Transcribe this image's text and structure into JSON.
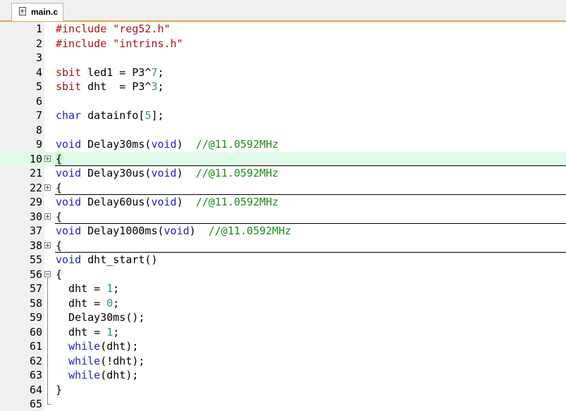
{
  "tab": {
    "label": "main.c",
    "icon": "c-file-icon"
  },
  "colors": {
    "tab_accent": "#d9a844",
    "current_line": "#e0fbe8",
    "keyword": "#1f1fc8",
    "string": "#a31515",
    "number": "#3a8a8a",
    "comment": "#1f8a1f"
  },
  "lines": [
    {
      "n": "1",
      "tokens": [
        [
          "pre",
          "#include"
        ],
        [
          "",
          " "
        ],
        [
          "str",
          "\"reg52.h\""
        ]
      ]
    },
    {
      "n": "2",
      "tokens": [
        [
          "pre",
          "#include"
        ],
        [
          "",
          " "
        ],
        [
          "str",
          "\"intrins.h\""
        ]
      ]
    },
    {
      "n": "3",
      "tokens": []
    },
    {
      "n": "4",
      "tokens": [
        [
          "pre",
          "sbit"
        ],
        [
          "",
          " led1 = P3^"
        ],
        [
          "num",
          "7"
        ],
        [
          "",
          ";"
        ]
      ]
    },
    {
      "n": "5",
      "tokens": [
        [
          "pre",
          "sbit"
        ],
        [
          "",
          " dht  = P3^"
        ],
        [
          "num",
          "3"
        ],
        [
          "",
          ";"
        ]
      ]
    },
    {
      "n": "6",
      "tokens": []
    },
    {
      "n": "7",
      "tokens": [
        [
          "kw",
          "char"
        ],
        [
          "",
          " datainfo["
        ],
        [
          "num",
          "5"
        ],
        [
          "",
          "];"
        ]
      ]
    },
    {
      "n": "8",
      "tokens": []
    },
    {
      "n": "9",
      "tokens": [
        [
          "kw",
          "void"
        ],
        [
          "",
          " Delay30ms("
        ],
        [
          "kw",
          "void"
        ],
        [
          "",
          ")  "
        ],
        [
          "cmt",
          "//@11.0592MHz"
        ]
      ]
    },
    {
      "n": "10",
      "tokens": [
        [
          "brace-hl",
          "{"
        ]
      ],
      "fold": "plus",
      "current": true,
      "sep": true
    },
    {
      "n": "21",
      "tokens": [
        [
          "kw",
          "void"
        ],
        [
          "",
          " Delay30us("
        ],
        [
          "kw",
          "void"
        ],
        [
          "",
          ")  "
        ],
        [
          "cmt",
          "//@11.0592MHz"
        ]
      ]
    },
    {
      "n": "22",
      "tokens": [
        [
          "",
          "{"
        ]
      ],
      "fold": "plus",
      "sep": true
    },
    {
      "n": "29",
      "tokens": [
        [
          "kw",
          "void"
        ],
        [
          "",
          " Delay60us("
        ],
        [
          "kw",
          "void"
        ],
        [
          "",
          ")  "
        ],
        [
          "cmt",
          "//@11.0592MHz"
        ]
      ]
    },
    {
      "n": "30",
      "tokens": [
        [
          "",
          "{"
        ]
      ],
      "fold": "plus",
      "sep": true
    },
    {
      "n": "37",
      "tokens": [
        [
          "kw",
          "void"
        ],
        [
          "",
          " Delay1000ms("
        ],
        [
          "kw",
          "void"
        ],
        [
          "",
          ")  "
        ],
        [
          "cmt",
          "//@11.0592MHz"
        ]
      ]
    },
    {
      "n": "38",
      "tokens": [
        [
          "",
          "{"
        ]
      ],
      "fold": "plus",
      "sep": true
    },
    {
      "n": "55",
      "tokens": [
        [
          "kw",
          "void"
        ],
        [
          "",
          " dht_start()"
        ]
      ]
    },
    {
      "n": "56",
      "tokens": [
        [
          "",
          "{"
        ]
      ],
      "fold": "minus"
    },
    {
      "n": "57",
      "tokens": [
        [
          "",
          "  dht = "
        ],
        [
          "num",
          "1"
        ],
        [
          "",
          ";"
        ]
      ]
    },
    {
      "n": "58",
      "tokens": [
        [
          "",
          "  dht = "
        ],
        [
          "num",
          "0"
        ],
        [
          "",
          ";"
        ]
      ]
    },
    {
      "n": "59",
      "tokens": [
        [
          "",
          "  Delay30ms();"
        ]
      ]
    },
    {
      "n": "60",
      "tokens": [
        [
          "",
          "  dht = "
        ],
        [
          "num",
          "1"
        ],
        [
          "",
          ";"
        ]
      ]
    },
    {
      "n": "61",
      "tokens": [
        [
          "",
          "  "
        ],
        [
          "kw",
          "while"
        ],
        [
          "",
          "(dht);"
        ]
      ]
    },
    {
      "n": "62",
      "tokens": [
        [
          "",
          "  "
        ],
        [
          "kw",
          "while"
        ],
        [
          "",
          "(!dht);"
        ]
      ]
    },
    {
      "n": "63",
      "tokens": [
        [
          "",
          "  "
        ],
        [
          "kw",
          "while"
        ],
        [
          "",
          "(dht);"
        ]
      ]
    },
    {
      "n": "64",
      "tokens": [
        [
          "",
          "}"
        ]
      ]
    },
    {
      "n": "65",
      "tokens": []
    }
  ]
}
